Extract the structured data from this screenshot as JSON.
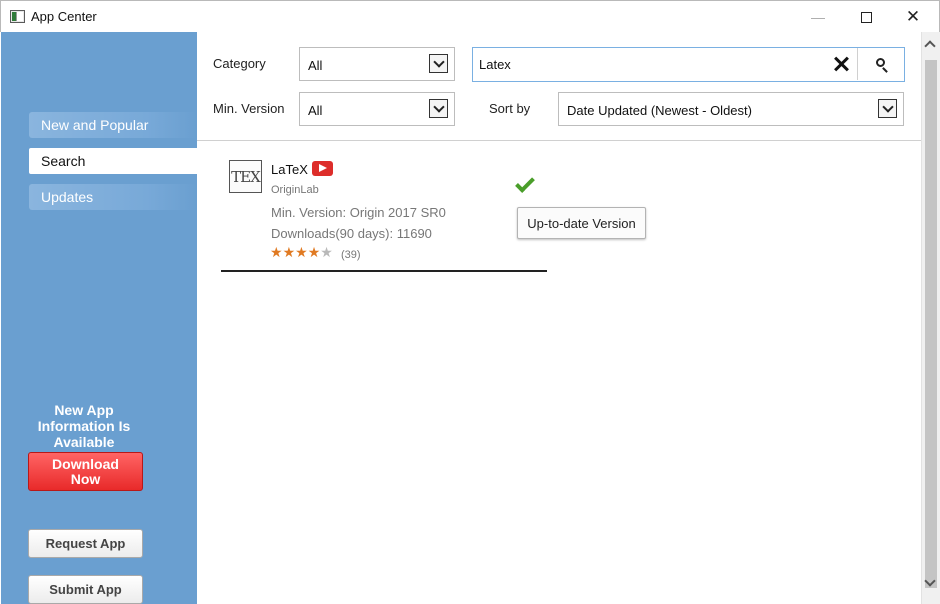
{
  "window": {
    "title": "App Center",
    "minimize_glyph": "—",
    "close_glyph": "✕"
  },
  "sidebar": {
    "items": [
      {
        "label": "New and Popular",
        "active": false
      },
      {
        "label": "Search",
        "active": true
      },
      {
        "label": "Updates",
        "active": false
      }
    ],
    "notice": "New App Information Is Available",
    "download_label": "Download Now",
    "request_label": "Request App",
    "submit_label": "Submit App"
  },
  "filters": {
    "category_label": "Category",
    "category_value": "All",
    "minver_label": "Min. Version",
    "minver_value": "All",
    "sortby_label": "Sort by",
    "sortby_value": "Date Updated (Newest - Oldest)",
    "search_value": "Latex"
  },
  "results": [
    {
      "logo_text": "TEX",
      "name": "LaTeX",
      "author": "OriginLab",
      "min_version": "Min. Version: Origin 2017 SR0",
      "downloads": "Downloads(90 days): 11690",
      "rating": 4,
      "rating_max": 5,
      "rating_count": "(39)",
      "status_label": "Up-to-date Version",
      "icons": [
        "youtube-icon",
        "checkmark-icon"
      ]
    }
  ],
  "colors": {
    "sidebar": "#6a9fd0",
    "download": "#e82a2a",
    "star": "#e07a22",
    "check": "#4a9e2a"
  }
}
